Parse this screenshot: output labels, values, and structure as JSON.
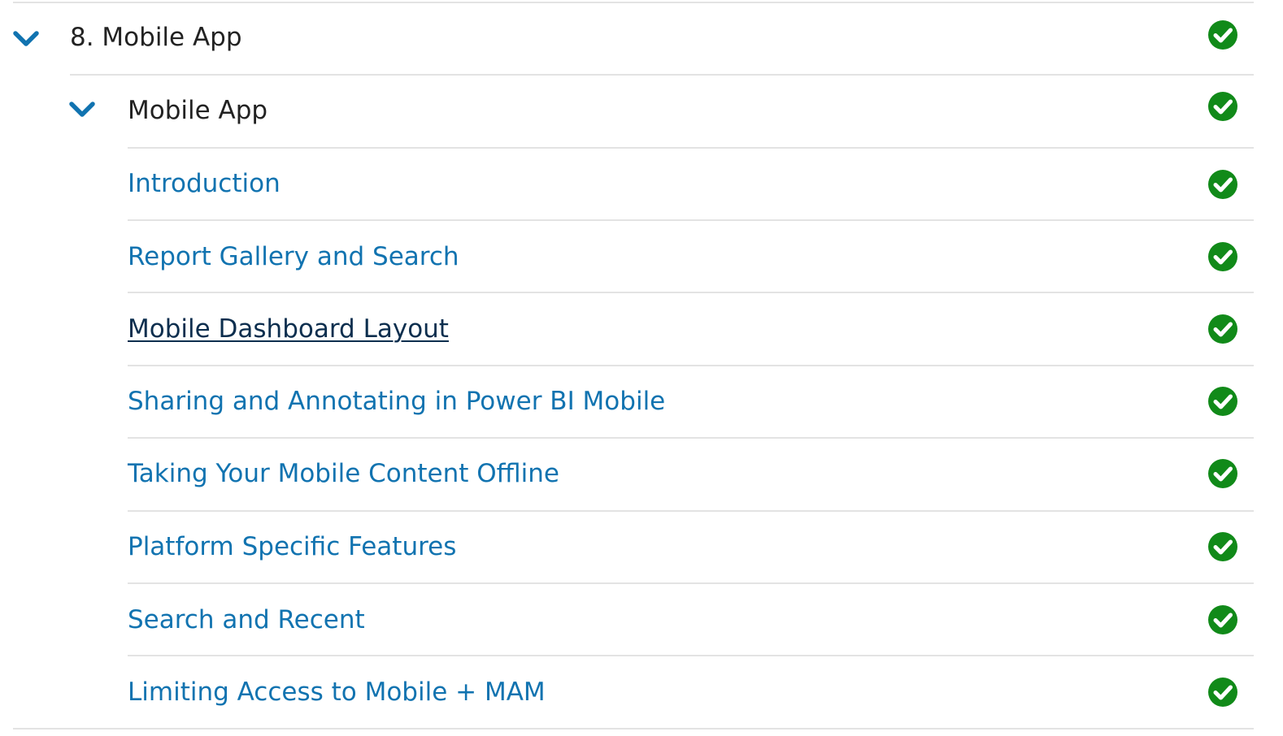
{
  "colors": {
    "link": "#1173b0",
    "link_active": "#0c2e4e",
    "text": "#222222",
    "complete": "#118a19",
    "divider": "#e3e3e3"
  },
  "module": {
    "title": "8. Mobile App",
    "expand_icon": "chevron-down-icon",
    "status_icon": "check-circle-icon",
    "complete": true
  },
  "section": {
    "title": "Mobile App",
    "expand_icon": "chevron-down-icon",
    "status_icon": "check-circle-icon",
    "complete": true
  },
  "lessons": [
    {
      "title": "Introduction",
      "complete": true,
      "active": false
    },
    {
      "title": "Report Gallery and Search",
      "complete": true,
      "active": false
    },
    {
      "title": "Mobile Dashboard Layout",
      "complete": true,
      "active": true
    },
    {
      "title": "Sharing and Annotating in Power BI Mobile",
      "complete": true,
      "active": false
    },
    {
      "title": "Taking Your Mobile Content Offline",
      "complete": true,
      "active": false
    },
    {
      "title": "Platform Specific Features",
      "complete": true,
      "active": false
    },
    {
      "title": "Search and Recent",
      "complete": true,
      "active": false
    },
    {
      "title": "Limiting Access to Mobile + MAM",
      "complete": true,
      "active": false
    }
  ]
}
